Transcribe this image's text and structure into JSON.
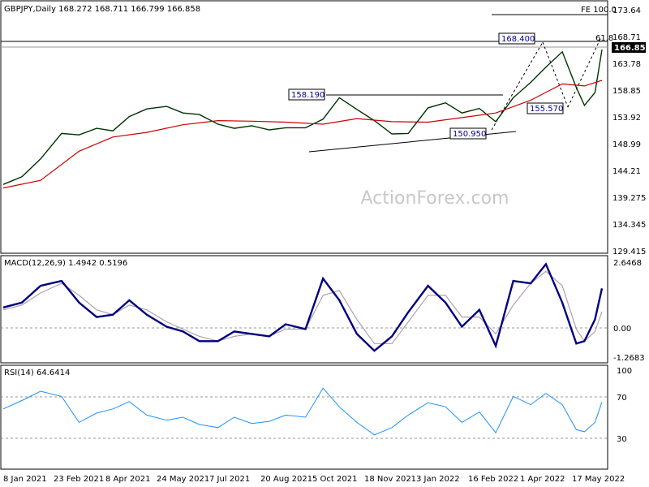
{
  "watermark": "ActionForex.com",
  "chart_data": [
    {
      "type": "ohlc",
      "title": "GBPJPY,Daily  168.272 168.711 166.799 166.858",
      "ylim": [
        127.0,
        176.5
      ],
      "y_ticks": [
        173.64,
        168.71,
        163.78,
        158.85,
        153.92,
        148.99,
        144.21,
        139.275,
        134.345,
        129.415
      ],
      "current_price": "166.858",
      "x_labels": [
        "8 Jan 2021",
        "23 Feb 2021",
        "8 Apr 2021",
        "24 May 2021",
        "7 Jul 2021",
        "20 Aug 2021",
        "5 Oct 2021",
        "18 Nov 2021",
        "3 Jan 2022",
        "16 Feb 2022",
        "1 Apr 2022",
        "17 May 2022"
      ],
      "series": [
        {
          "name": "",
          "x": [
            "2021-01-04",
            "2021-01-20",
            "2021-02-05",
            "2021-02-23",
            "2021-03-10",
            "2021-03-25",
            "2021-04-08",
            "2021-04-22",
            "2021-05-07",
            "2021-05-24",
            "2021-06-07",
            "2021-06-21",
            "2021-07-07",
            "2021-07-21",
            "2021-08-05",
            "2021-08-20",
            "2021-09-03",
            "2021-09-20",
            "2021-10-05",
            "2021-10-19",
            "2021-11-03",
            "2021-11-18",
            "2021-12-03",
            "2021-12-17",
            "2022-01-03",
            "2022-01-18",
            "2022-02-01",
            "2022-02-16",
            "2022-03-02",
            "2022-03-17",
            "2022-04-01",
            "2022-04-14",
            "2022-04-28",
            "2022-05-10",
            "2022-05-17",
            "2022-05-26",
            "2022-06-01"
          ],
          "close": [
            140.5,
            142.0,
            145.5,
            150.5,
            150.2,
            151.5,
            151.0,
            153.8,
            155.3,
            155.8,
            154.5,
            154.2,
            152.3,
            151.5,
            152.0,
            151.2,
            151.6,
            151.6,
            153.3,
            157.5,
            155.2,
            153.0,
            150.4,
            150.5,
            155.5,
            156.5,
            154.5,
            155.4,
            152.8,
            157.5,
            160.5,
            163.5,
            166.5,
            159.5,
            156.0,
            158.5,
            166.9
          ]
        },
        {
          "name": "",
          "x": [
            "2021-01-04",
            "2021-02-05",
            "2021-03-10",
            "2021-04-08",
            "2021-05-07",
            "2021-06-07",
            "2021-07-07",
            "2021-08-05",
            "2021-09-03",
            "2021-10-05",
            "2021-11-03",
            "2021-12-03",
            "2022-01-03",
            "2022-02-01",
            "2022-03-02",
            "2022-04-01",
            "2022-04-28",
            "2022-05-17",
            "2022-06-01"
          ],
          "close": [
            139.8,
            141.3,
            147.0,
            149.8,
            150.7,
            152.2,
            153.0,
            152.9,
            152.7,
            152.3,
            153.4,
            152.8,
            152.7,
            153.6,
            154.5,
            157.0,
            160.2,
            159.8,
            160.9
          ]
        }
      ],
      "annotations": [
        "158.190",
        "168.400",
        "155.570",
        "150.950",
        "FE 100.0",
        "61.8"
      ],
      "annotation_values": [
        158.19,
        168.4,
        155.57,
        150.95,
        173.64,
        168.71
      ]
    },
    {
      "type": "line",
      "title": "MACD(12,26,9) 1.4942 0.5196",
      "ylim": [
        -1.6,
        2.85
      ],
      "y_ticks": [
        "2.6468",
        "0.00",
        "-1.2683"
      ],
      "series": [
        {
          "name": "",
          "x": [
            "2021-01-04",
            "2021-01-20",
            "2021-02-05",
            "2021-02-23",
            "2021-03-10",
            "2021-03-25",
            "2021-04-08",
            "2021-04-22",
            "2021-05-07",
            "2021-05-24",
            "2021-06-07",
            "2021-06-21",
            "2021-07-07",
            "2021-07-21",
            "2021-08-05",
            "2021-08-20",
            "2021-09-03",
            "2021-09-20",
            "2021-10-05",
            "2021-10-19",
            "2021-11-03",
            "2021-11-18",
            "2021-12-03",
            "2021-12-17",
            "2022-01-03",
            "2022-01-18",
            "2022-02-01",
            "2022-02-16",
            "2022-03-02",
            "2022-03-17",
            "2022-04-01",
            "2022-04-14",
            "2022-04-28",
            "2022-05-10",
            "2022-05-17",
            "2022-05-26",
            "2022-06-01"
          ],
          "values": [
            0.7,
            0.9,
            1.6,
            1.8,
            0.9,
            0.3,
            0.4,
            1.0,
            0.4,
            -0.1,
            -0.3,
            -0.7,
            -0.7,
            -0.3,
            -0.4,
            -0.5,
            0.0,
            -0.2,
            1.9,
            1.0,
            -0.4,
            -1.1,
            -0.5,
            0.5,
            1.6,
            0.9,
            -0.1,
            0.6,
            -0.9,
            1.8,
            1.7,
            2.5,
            0.9,
            -0.8,
            -0.7,
            0.2,
            1.49
          ]
        },
        {
          "name": "",
          "x": [
            "2021-01-04",
            "2021-01-20",
            "2021-02-05",
            "2021-02-23",
            "2021-03-10",
            "2021-03-25",
            "2021-04-08",
            "2021-04-22",
            "2021-05-07",
            "2021-05-24",
            "2021-06-07",
            "2021-06-21",
            "2021-07-07",
            "2021-07-21",
            "2021-08-05",
            "2021-08-20",
            "2021-09-03",
            "2021-09-20",
            "2021-10-05",
            "2021-10-19",
            "2021-11-03",
            "2021-11-18",
            "2021-12-03",
            "2021-12-17",
            "2022-01-03",
            "2022-01-18",
            "2022-02-01",
            "2022-02-16",
            "2022-03-02",
            "2022-03-17",
            "2022-04-01",
            "2022-04-14",
            "2022-04-28",
            "2022-05-10",
            "2022-05-17",
            "2022-05-26",
            "2022-06-01"
          ],
          "values": [
            0.6,
            0.8,
            1.3,
            1.7,
            1.2,
            0.6,
            0.4,
            0.8,
            0.6,
            0.1,
            -0.2,
            -0.5,
            -0.7,
            -0.5,
            -0.4,
            -0.5,
            -0.2,
            -0.2,
            1.2,
            1.4,
            0.2,
            -0.8,
            -0.8,
            0.1,
            1.2,
            1.2,
            0.3,
            0.3,
            -0.4,
            0.8,
            1.7,
            2.2,
            1.6,
            -0.2,
            -0.7,
            -0.3,
            0.52
          ]
        }
      ]
    },
    {
      "type": "line",
      "title": "RSI(14) 64.6414",
      "ylim": [
        0,
        100
      ],
      "y_ticks": [
        "100",
        "70",
        "30",
        "0"
      ],
      "series": [
        {
          "name": "",
          "x": [
            "2021-01-04",
            "2021-01-20",
            "2021-02-05",
            "2021-02-23",
            "2021-03-10",
            "2021-03-25",
            "2021-04-08",
            "2021-04-22",
            "2021-05-07",
            "2021-05-24",
            "2021-06-07",
            "2021-06-21",
            "2021-07-07",
            "2021-07-21",
            "2021-08-05",
            "2021-08-20",
            "2021-09-03",
            "2021-09-20",
            "2021-10-05",
            "2021-10-19",
            "2021-11-03",
            "2021-11-18",
            "2021-12-03",
            "2021-12-17",
            "2022-01-03",
            "2022-01-18",
            "2022-02-01",
            "2022-02-16",
            "2022-03-02",
            "2022-03-17",
            "2022-04-01",
            "2022-04-14",
            "2022-04-28",
            "2022-05-10",
            "2022-05-17",
            "2022-05-26",
            "2022-06-01"
          ],
          "values": [
            58,
            66,
            75,
            70,
            45,
            54,
            58,
            65,
            52,
            47,
            50,
            43,
            40,
            50,
            44,
            46,
            52,
            50,
            78,
            60,
            45,
            33,
            40,
            52,
            64,
            60,
            45,
            55,
            35,
            70,
            62,
            73,
            62,
            38,
            36,
            45,
            64.6
          ]
        }
      ]
    }
  ]
}
